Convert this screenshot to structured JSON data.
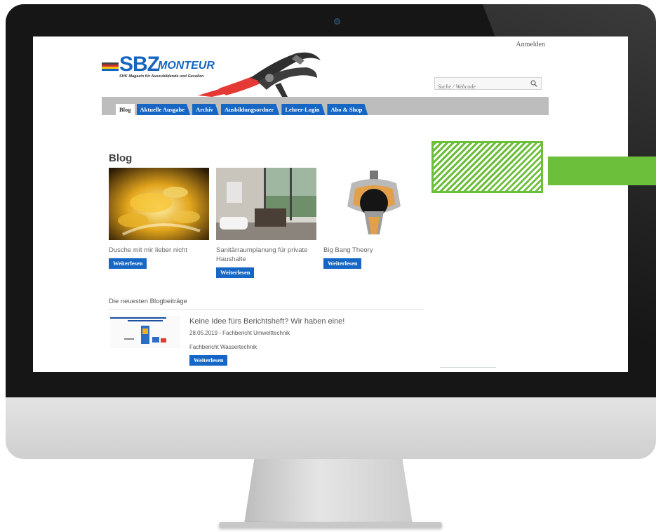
{
  "header": {
    "login_label": "Anmelden",
    "logo": {
      "brand": "SBZ",
      "product": "MONTEUR",
      "tagline": "SHK-Magazin für Auszubildende und Gesellen"
    },
    "search": {
      "placeholder": "Suche / Webcode",
      "value": ""
    }
  },
  "nav": {
    "items": [
      {
        "label": "Blog",
        "active": true
      },
      {
        "label": "Aktuelle Ausgabe",
        "active": false
      },
      {
        "label": "Archiv",
        "active": false
      },
      {
        "label": "Ausbildungsordner",
        "active": false
      },
      {
        "label": "Lehrer-Login",
        "active": false
      },
      {
        "label": "Abo & Shop",
        "active": false
      }
    ]
  },
  "blog": {
    "title": "Blog",
    "cards": [
      {
        "title": "Dusche mit mir lieber nicht",
        "button": "Weiterlesen"
      },
      {
        "title": "Sanitärraumplanung für private Haushalte",
        "button": "Weiterlesen"
      },
      {
        "title": "Big Bang Theory",
        "button": "Weiterlesen"
      }
    ]
  },
  "latest": {
    "heading": "Die neuesten Blogbeiträge",
    "post": {
      "title": "Keine Idee fürs Berichtsheft? Wir haben eine!",
      "meta": "28.05.2019 - Fachbericht Umwelttechnik",
      "category": "Fachbericht Wassertechnik",
      "button": "Weiterlesen"
    }
  },
  "colors": {
    "brand_blue": "#1666c5",
    "nav_gray": "#bdbdbd",
    "accent_green": "#6cbf3b",
    "bezel": "#161616"
  }
}
